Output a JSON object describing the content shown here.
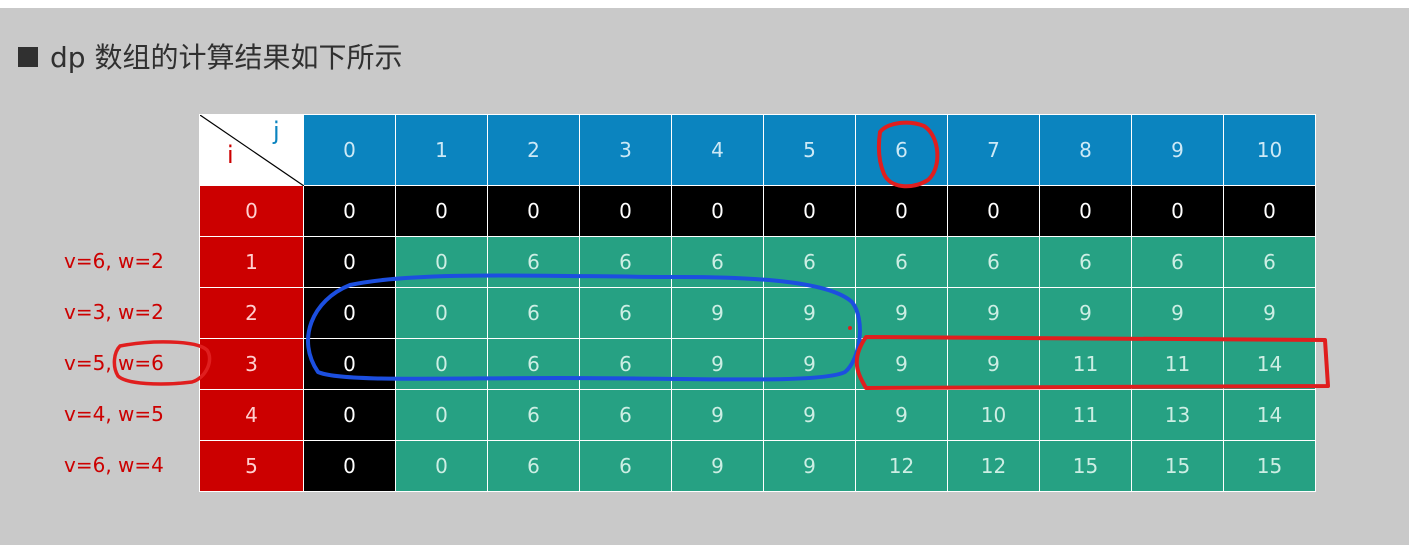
{
  "heading": "dp 数组的计算结果如下所示",
  "corner": {
    "row_symbol": "i",
    "col_symbol": "j"
  },
  "columns": [
    "0",
    "1",
    "2",
    "3",
    "4",
    "5",
    "6",
    "7",
    "8",
    "9",
    "10"
  ],
  "rows": [
    {
      "i": "0",
      "label": "",
      "values": [
        "0",
        "0",
        "0",
        "0",
        "0",
        "0",
        "0",
        "0",
        "0",
        "0",
        "0"
      ]
    },
    {
      "i": "1",
      "label": "v=6, w=2",
      "values": [
        "0",
        "0",
        "6",
        "6",
        "6",
        "6",
        "6",
        "6",
        "6",
        "6",
        "6"
      ]
    },
    {
      "i": "2",
      "label": "v=3, w=2",
      "values": [
        "0",
        "0",
        "6",
        "6",
        "9",
        "9",
        "9",
        "9",
        "9",
        "9",
        "9"
      ]
    },
    {
      "i": "3",
      "label": "v=5, w=6",
      "values": [
        "0",
        "0",
        "6",
        "6",
        "9",
        "9",
        "9",
        "9",
        "11",
        "11",
        "14"
      ]
    },
    {
      "i": "4",
      "label": "v=4, w=5",
      "values": [
        "0",
        "0",
        "6",
        "6",
        "9",
        "9",
        "9",
        "10",
        "11",
        "13",
        "14"
      ]
    },
    {
      "i": "5",
      "label": "v=6, w=4",
      "values": [
        "0",
        "0",
        "6",
        "6",
        "9",
        "9",
        "12",
        "12",
        "15",
        "15",
        "15"
      ]
    }
  ],
  "colors": {
    "header_blue": "#0b84bf",
    "row_header_red": "#cc0000",
    "zero_column_black": "#000000",
    "cell_green": "#26a183",
    "ink_blue": "#1c4fe0",
    "ink_red": "#e01e1e"
  }
}
